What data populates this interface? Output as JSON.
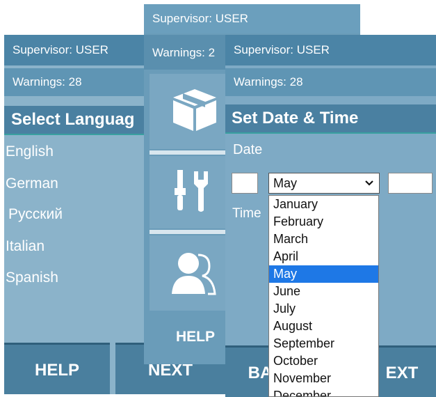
{
  "left_panel": {
    "supervisor": "Supervisor: USER",
    "warnings": "Warnings: 28",
    "heading": "Select Languag",
    "languages": [
      "English",
      "German",
      "Русский",
      "Italian",
      "Spanish"
    ],
    "help_button": "HELP",
    "next_button": "NEXT"
  },
  "middle_panel": {
    "supervisor": "Supervisor: USER",
    "warnings": "Warnings: 2",
    "tiles": [
      "box-icon",
      "tools-icon",
      "users-icon"
    ],
    "help_label": "HELP"
  },
  "right_panel": {
    "supervisor": "Supervisor: USER",
    "warnings": "Warnings: 28",
    "heading": "Set Date & Time",
    "date_label": "Date",
    "time_label": "Time",
    "month_selected": "May",
    "months": [
      "January",
      "February",
      "March",
      "April",
      "May",
      "June",
      "July",
      "August",
      "September",
      "October",
      "November",
      "December"
    ],
    "back_button": "BA",
    "next_button": "EXT"
  },
  "colors": {
    "header_blue": "#4b84a6",
    "panel_blue": "#8bb3ca",
    "button_blue": "#4a7f9e",
    "accent_line": "#39a0a0",
    "option_highlight": "#1e78e6"
  }
}
